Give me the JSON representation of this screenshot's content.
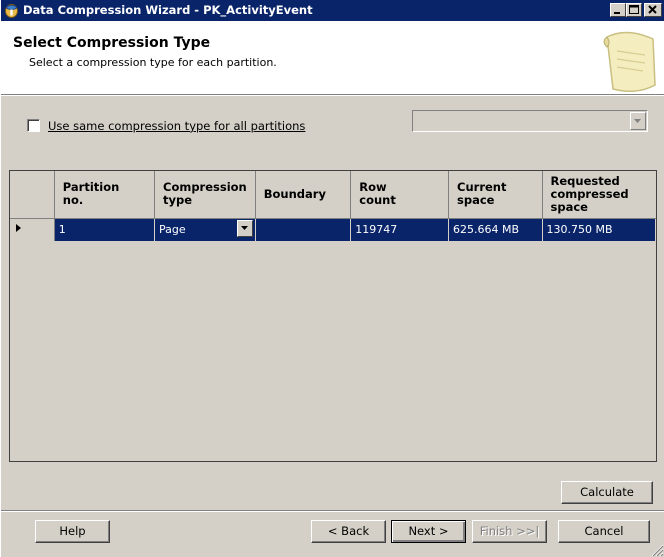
{
  "window": {
    "title": "Data Compression Wizard - PK_ActivityEvent"
  },
  "header": {
    "title": "Select Compression Type",
    "subtitle": "Select a compression type for each partition."
  },
  "options": {
    "same_type_label": "Use same compression type for all partitions",
    "same_type_checked": false,
    "same_type_value": ""
  },
  "grid": {
    "columns": [
      {
        "line1": "Partition",
        "line2": "no.",
        "line3": ""
      },
      {
        "line1": "Compression",
        "line2": "type",
        "line3": ""
      },
      {
        "line1": "Boundary",
        "line2": "",
        "line3": ""
      },
      {
        "line1": "Row",
        "line2": "count",
        "line3": ""
      },
      {
        "line1": "Current",
        "line2": "space",
        "line3": ""
      },
      {
        "line1": "Requested",
        "line2": "compressed",
        "line3": "space"
      }
    ],
    "rows": [
      {
        "partition_no": "1",
        "compression_type": "Page",
        "boundary": "",
        "row_count": "119747",
        "current_space": "625.664 MB",
        "requested_space": "130.750 MB"
      }
    ]
  },
  "buttons": {
    "calculate": "Calculate",
    "help": "Help",
    "back": "< Back",
    "next": "Next >",
    "finish": "Finish >>|",
    "cancel": "Cancel"
  },
  "colors": {
    "titlebar": "#0a246a",
    "selection": "#0a246a",
    "face": "#d4d0c8"
  },
  "icons": [
    "app-icon",
    "minimize-icon",
    "maximize-icon",
    "close-icon",
    "scroll-icon",
    "row-pointer-icon",
    "dropdown-arrow-icon",
    "size-grip-icon"
  ]
}
